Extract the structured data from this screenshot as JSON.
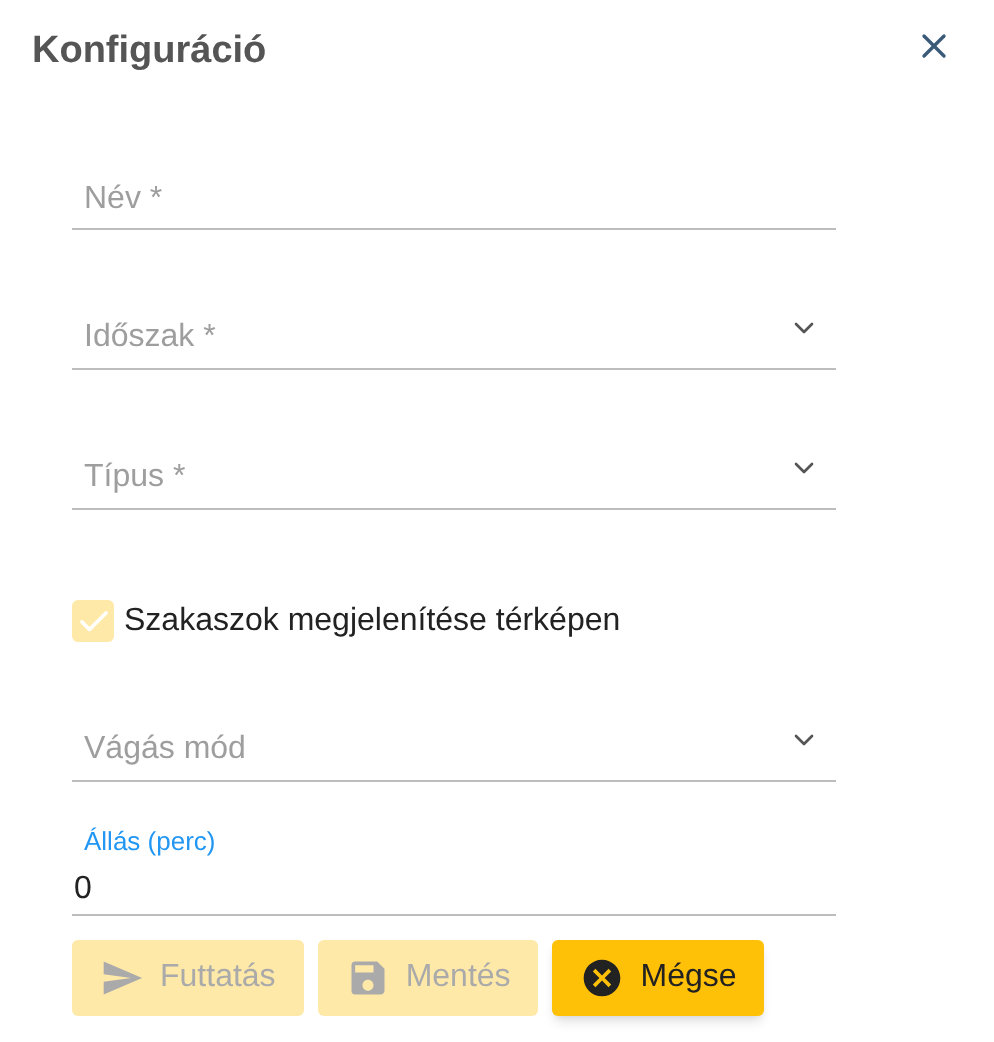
{
  "title": "Konfiguráció",
  "form": [
    {
      "kind": "text",
      "placeholder": "Név *"
    },
    {
      "kind": "select",
      "placeholder": "Időszak *"
    },
    {
      "kind": "select",
      "placeholder": "Típus *"
    },
    {
      "kind": "checkbox",
      "label": "Szakaszok megjelenítése térképen",
      "checked": true,
      "disabled": true
    },
    {
      "kind": "select",
      "placeholder": "Vágás mód"
    },
    {
      "kind": "number",
      "label": "Állás (perc)",
      "value": "0"
    }
  ],
  "buttons": [
    {
      "label": "Futtatás",
      "kind": "run",
      "disabled": true
    },
    {
      "label": "Mentés",
      "kind": "save",
      "disabled": true
    },
    {
      "label": "Mégse",
      "kind": "cancel",
      "disabled": false
    }
  ]
}
